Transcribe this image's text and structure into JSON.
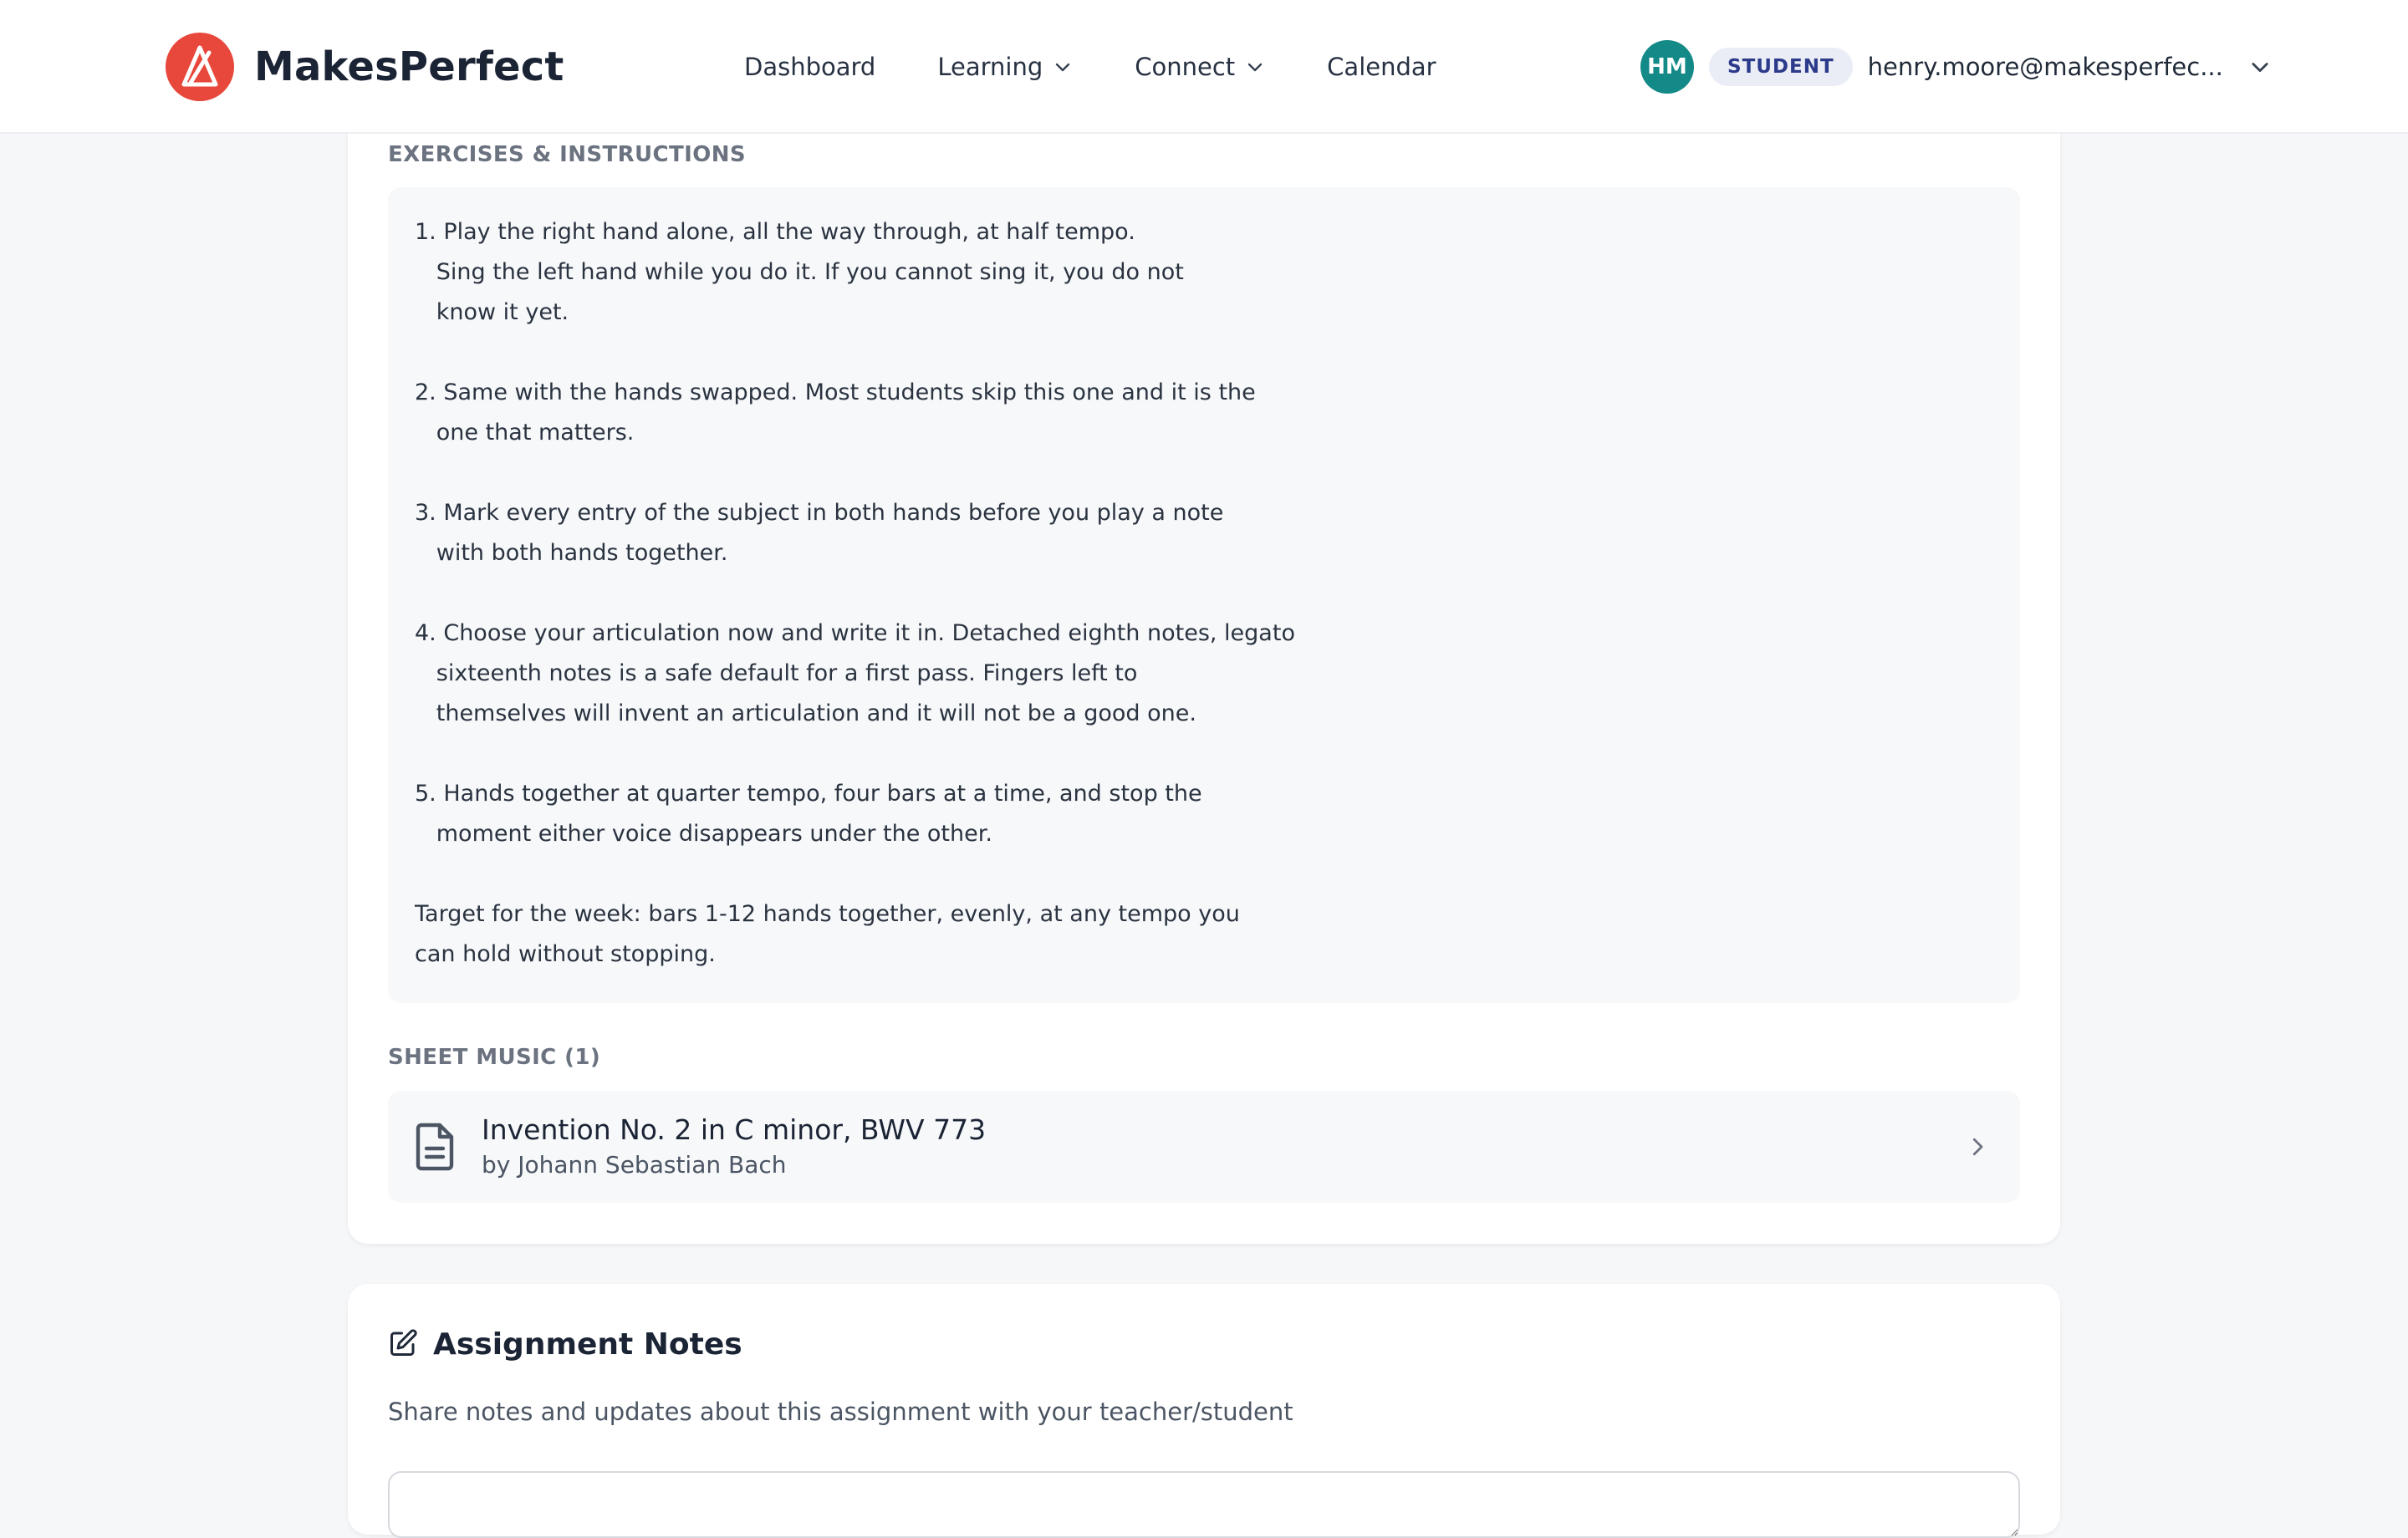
{
  "app": {
    "name": "MakesPerfect"
  },
  "nav": {
    "items": [
      {
        "label": "Dashboard"
      },
      {
        "label": "Learning"
      },
      {
        "label": "Connect"
      },
      {
        "label": "Calendar"
      }
    ]
  },
  "user": {
    "initials": "HM",
    "role": "STUDENT",
    "email": "henry.moore@makesperfec...",
    "avatar_color": "#138a87"
  },
  "assignment": {
    "exercises_label": "EXERCISES & INSTRUCTIONS",
    "instructions": "1. Play the right hand alone, all the way through, at half tempo.\n   Sing the left hand while you do it. If you cannot sing it, you do not\n   know it yet.\n\n2. Same with the hands swapped. Most students skip this one and it is the\n   one that matters.\n\n3. Mark every entry of the subject in both hands before you play a note\n   with both hands together.\n\n4. Choose your articulation now and write it in. Detached eighth notes, legato\n   sixteenth notes is a safe default for a first pass. Fingers left to\n   themselves will invent an articulation and it will not be a good one.\n\n5. Hands together at quarter tempo, four bars at a time, and stop the\n   moment either voice disappears under the other.\n\nTarget for the week: bars 1-12 hands together, evenly, at any tempo you\ncan hold without stopping.",
    "sheet_music_label": "SHEET MUSIC (1)",
    "sheet_music": [
      {
        "title": "Invention No. 2 in C minor, BWV 773",
        "composer": "by Johann Sebastian Bach"
      }
    ]
  },
  "notes": {
    "title": "Assignment Notes",
    "subtitle": "Share notes and updates about this assignment with your teacher/student",
    "input_value": ""
  },
  "icons": {
    "logo": "metronome-icon",
    "learning_dropdown": "chevron-down-icon",
    "connect_dropdown": "chevron-down-icon",
    "user_menu": "chevron-down-icon",
    "sheet_music": "document-icon",
    "sheet_open": "chevron-right-icon",
    "notes": "edit-icon"
  },
  "colors": {
    "brand": "#e8473c",
    "badge_bg": "#eaedf6",
    "badge_text": "#2b3a8a"
  }
}
